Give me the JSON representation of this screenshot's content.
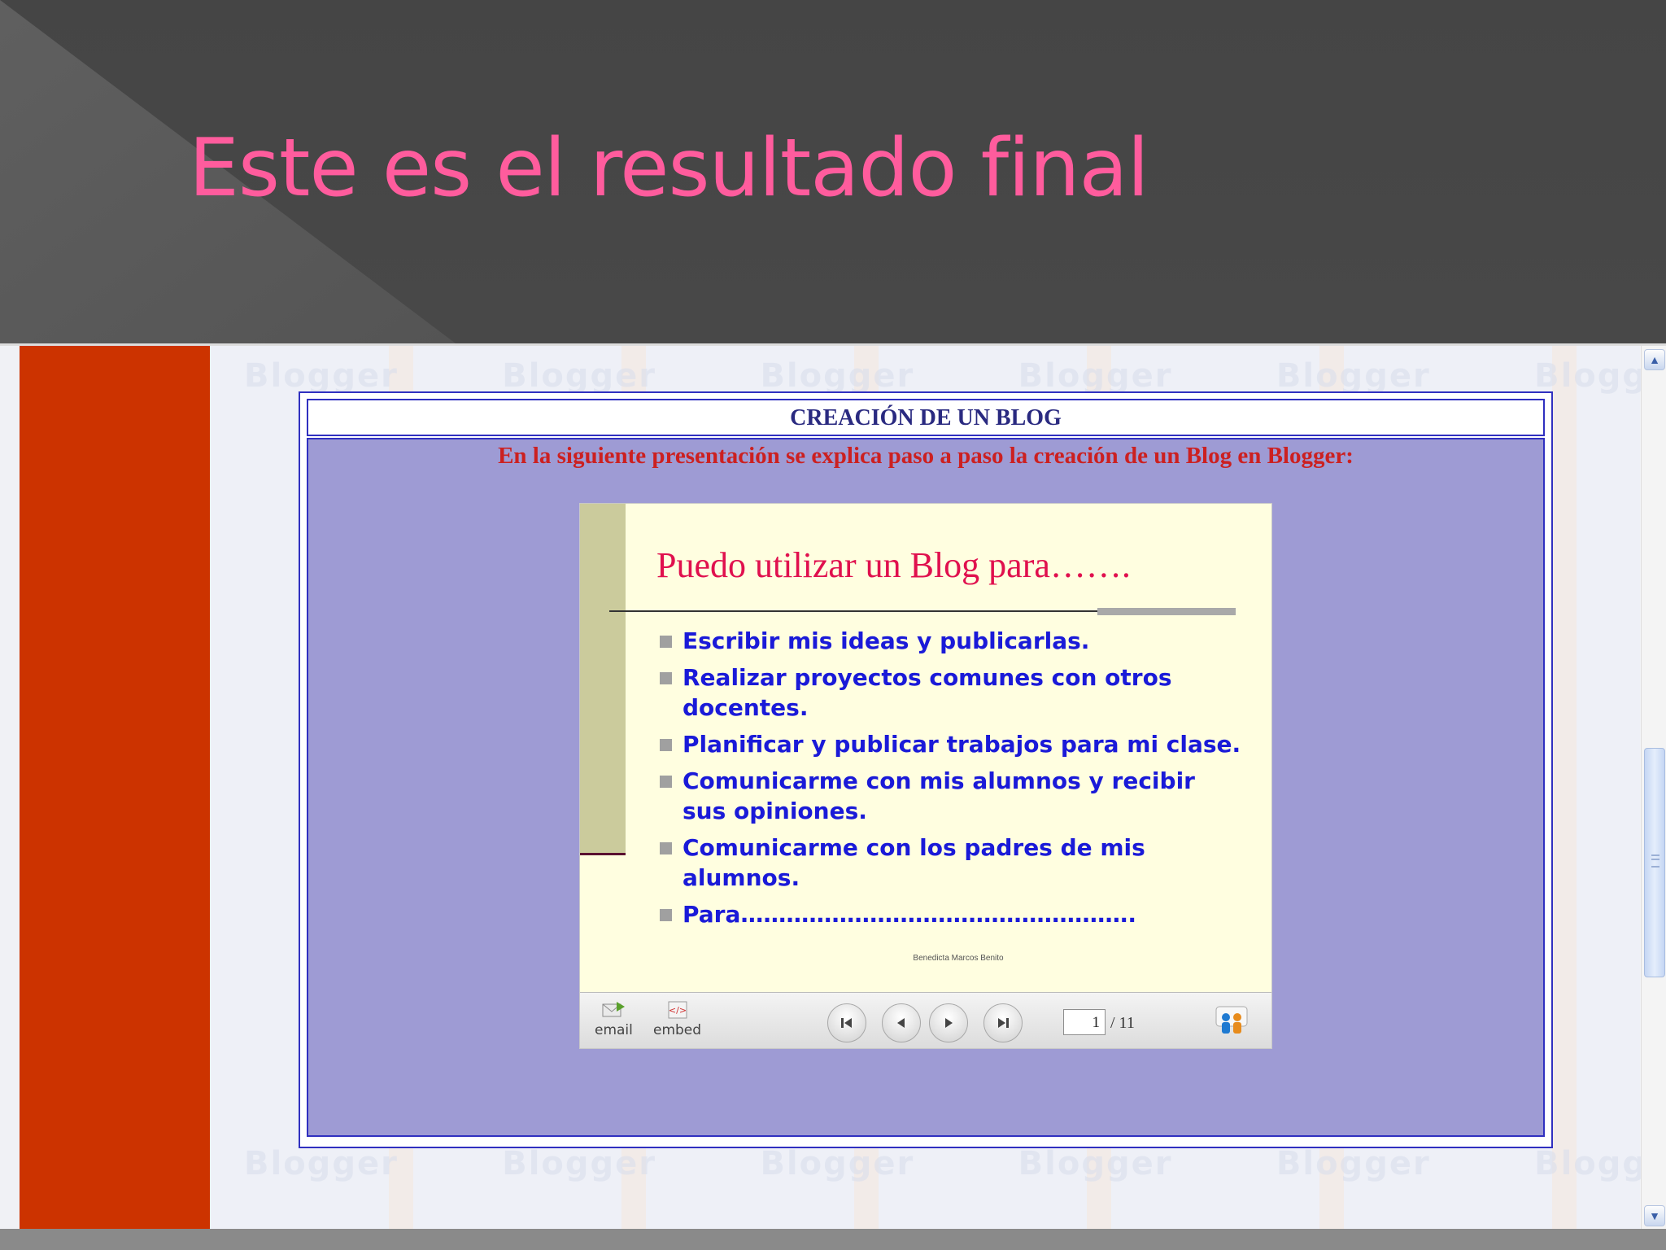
{
  "slide": {
    "title": "Este es el resultado final",
    "title_color": "#ff5c9d",
    "background_color": "#4a4a4a"
  },
  "browser": {
    "sidebar_color": "#cc3300",
    "watermark_text": "Blogger",
    "scrollbar": {
      "up_icon": "arrow-up-icon",
      "down_icon": "arrow-down-icon"
    }
  },
  "blog": {
    "header": "CREACIÓN DE UN BLOG",
    "intro": "En la siguiente presentación se explica paso a paso la creación de un Blog en Blogger:",
    "panel_color": "#9e9bd4",
    "border_color": "#3030c0"
  },
  "embedded_slide": {
    "title": "Puedo utilizar un Blog para…….",
    "bullets": [
      "Escribir mis ideas y publicarlas.",
      "Realizar proyectos comunes con otros docentes.",
      "Planificar y publicar trabajos para mi clase.",
      "Comunicarme con mis alumnos y recibir sus opiniones.",
      "Comunicarme con los padres de mis alumnos.",
      "Para……………………………………………."
    ],
    "author": "Benedicta Marcos Benito",
    "title_color": "#e0104e",
    "bullet_color": "#1a1ad8"
  },
  "player": {
    "email_label": "email",
    "embed_label": "embed",
    "current_page": "1",
    "total_pages": "/ 11"
  }
}
